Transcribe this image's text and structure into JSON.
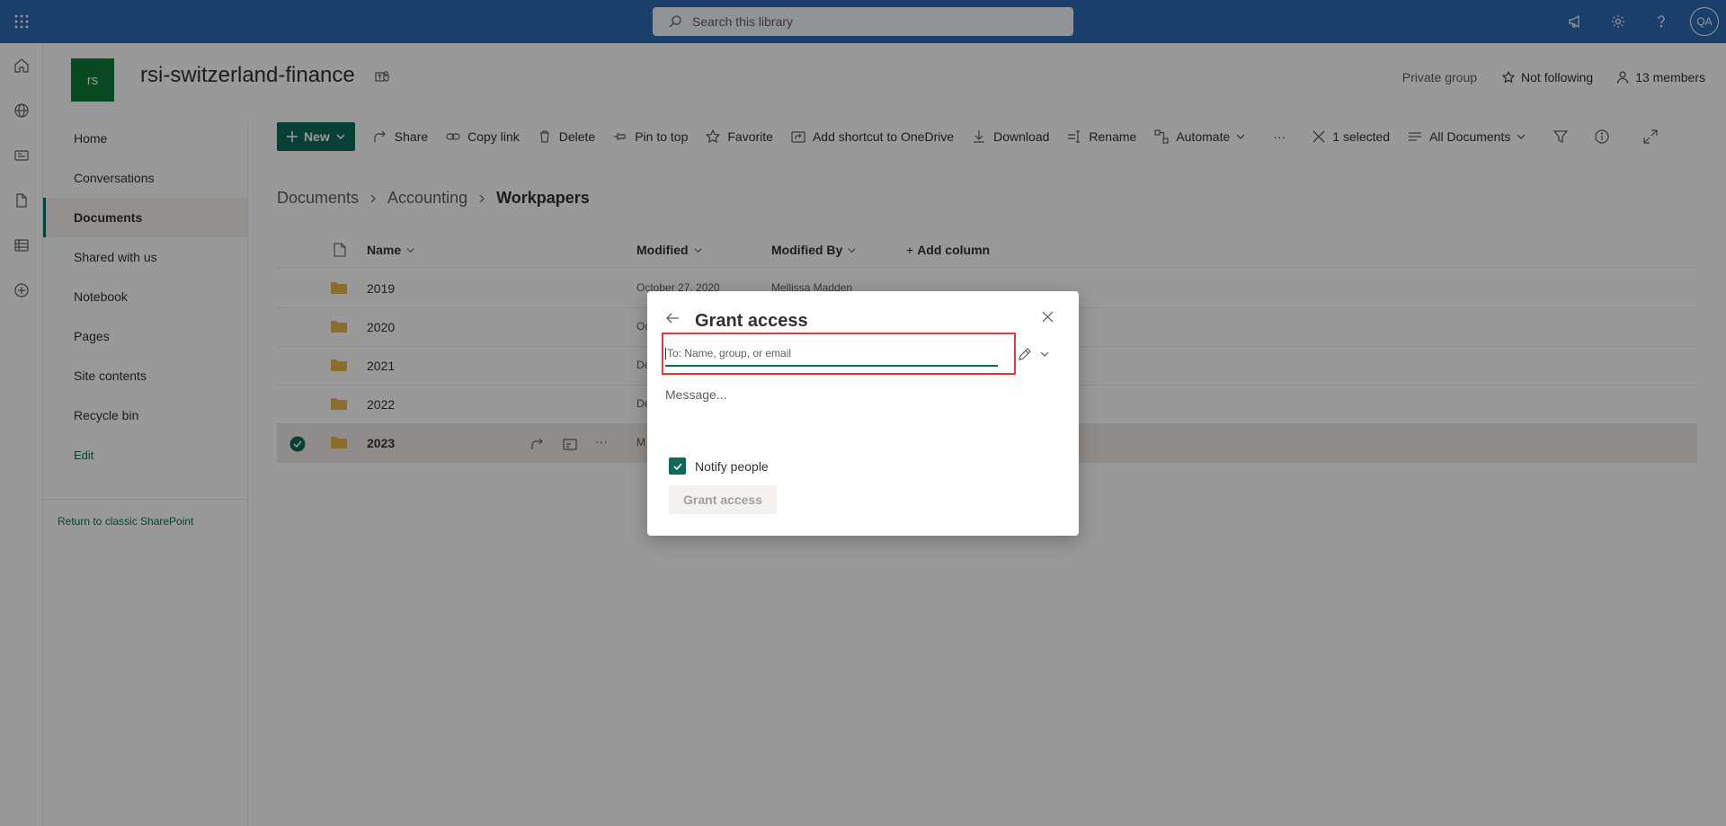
{
  "suite": {
    "search_placeholder": "Search this library",
    "avatar": "QA",
    "icons": [
      "megaphone-icon",
      "settings-gear-icon",
      "help-icon"
    ]
  },
  "rail": {
    "icons": [
      "home-icon",
      "globe-icon",
      "news-icon",
      "file-icon",
      "list-icon",
      "add-circle-icon"
    ]
  },
  "site": {
    "logo": "rs",
    "title": "rsi-switzerland-finance",
    "privacy": "Private group",
    "follow": "Not following",
    "members": "13 members"
  },
  "nav": {
    "items": [
      "Home",
      "Conversations",
      "Documents",
      "Shared with us",
      "Notebook",
      "Pages",
      "Site contents",
      "Recycle bin"
    ],
    "selected": "Documents",
    "edit": "Edit",
    "classic": "Return to classic SharePoint"
  },
  "cmd": {
    "new": "New",
    "share": "Share",
    "copy_link": "Copy link",
    "delete": "Delete",
    "pin": "Pin to top",
    "favorite": "Favorite",
    "shortcut": "Add shortcut to OneDrive",
    "download": "Download",
    "rename": "Rename",
    "automate": "Automate",
    "more": "···",
    "selected": "1 selected",
    "view": "All Documents"
  },
  "breadcrumb": [
    "Documents",
    "Accounting",
    "Workpapers"
  ],
  "list": {
    "columns": {
      "name": "Name",
      "modified": "Modified",
      "modified_by": "Modified By",
      "add": "Add column"
    },
    "rows": [
      {
        "name": "2019",
        "modified": "October 27, 2020",
        "by": "Mellissa Madden",
        "selected": false
      },
      {
        "name": "2020",
        "modified": "Oc",
        "by": "",
        "selected": false
      },
      {
        "name": "2021",
        "modified": "De",
        "by": "",
        "selected": false
      },
      {
        "name": "2022",
        "modified": "De",
        "by": "",
        "selected": false
      },
      {
        "name": "2023",
        "modified": "M",
        "by": "",
        "selected": true
      }
    ]
  },
  "dialog": {
    "title": "Grant access",
    "to_placeholder": "To: Name, group, or email",
    "message_placeholder": "Message...",
    "notify": "Notify people",
    "notify_checked": true,
    "button": "Grant access"
  },
  "colors": {
    "suitebar": "#2e69b3",
    "accent": "#0f6b59",
    "site_logo": "#0e7a3a",
    "highlight": "#e03a3a"
  }
}
